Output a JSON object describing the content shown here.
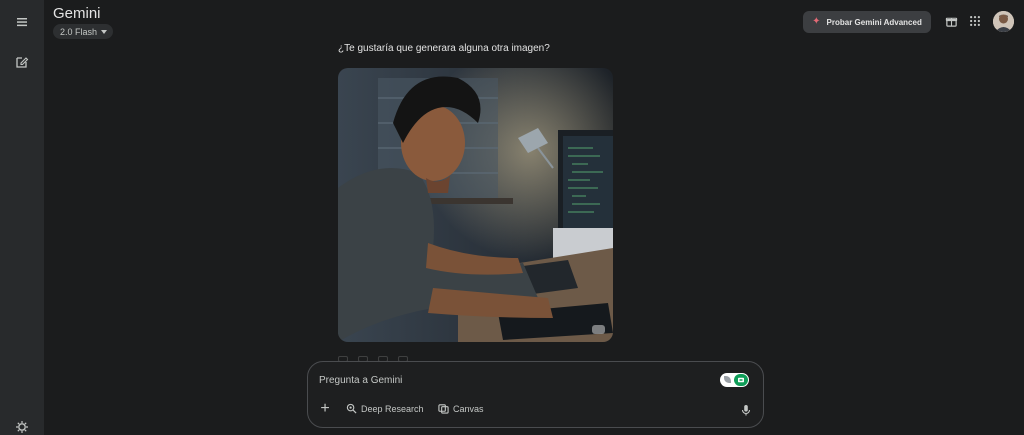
{
  "header": {
    "title": "Gemini",
    "model_label": "2.0 Flash",
    "advanced_label": "Probar Gemini Advanced"
  },
  "rail": {
    "menu_icon": "menu-icon",
    "new_chat_icon": "edit-icon",
    "settings_icon": "settings-icon"
  },
  "top_icons": [
    "gift-icon",
    "apps-grid-icon"
  ],
  "conversation": {
    "question": "¿Te gustaría que generara alguna otra imagen?"
  },
  "composer": {
    "placeholder": "Pregunta a Gemini",
    "tools": [
      {
        "label": "Deep Research",
        "icon": "deep-research-icon"
      },
      {
        "label": "Canvas",
        "icon": "canvas-icon"
      }
    ]
  },
  "colors": {
    "background": "#1b1c1d",
    "rail": "#282a2c",
    "accent_sparkle": "#e46a76",
    "toggle_green": "#0f9d58"
  }
}
